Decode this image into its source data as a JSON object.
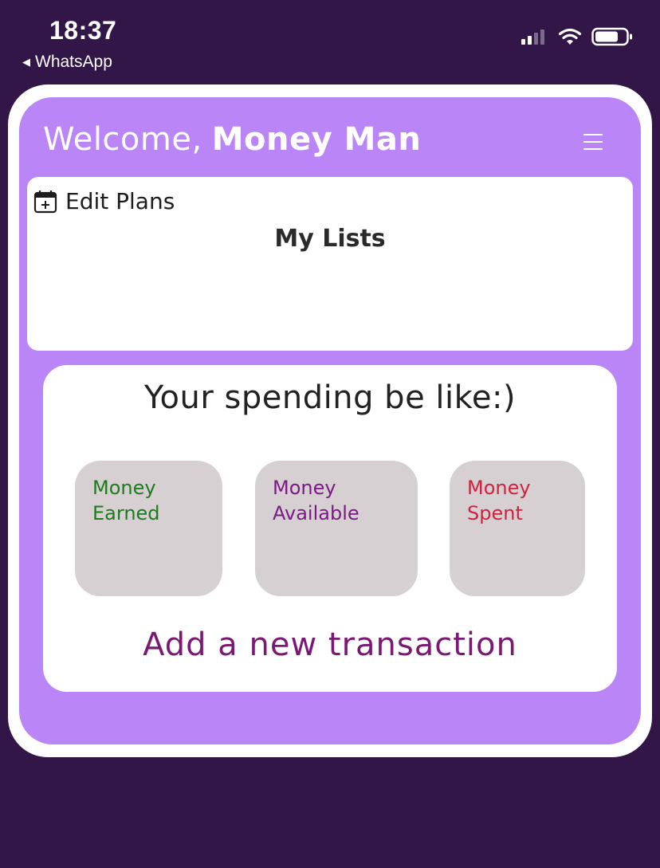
{
  "status_bar": {
    "time": "18:37",
    "back_label": "WhatsApp",
    "icons": [
      "signal-icon",
      "wifi-icon",
      "battery-icon"
    ]
  },
  "header": {
    "welcome_prefix": "Welcome,",
    "user_name": "Money Man",
    "menu_icon": "menu-icon"
  },
  "lists": {
    "edit_plans_label": "Edit Plans",
    "edit_plans_icon": "calendar-add-icon",
    "title": "My Lists"
  },
  "spending": {
    "title": "Your spending be like:)",
    "cards": [
      {
        "label": "Money\nEarned",
        "color": "#1f7a1f"
      },
      {
        "label": "Money\nAvailable",
        "color": "#7b1a86"
      },
      {
        "label": "Money\nSpent",
        "color": "#d2203f"
      }
    ],
    "add_transaction_label": "Add a new transaction"
  },
  "colors": {
    "background": "#321647",
    "accent": "#b985f7",
    "card": "#d6d0d2",
    "add_transaction": "#7b1775"
  }
}
